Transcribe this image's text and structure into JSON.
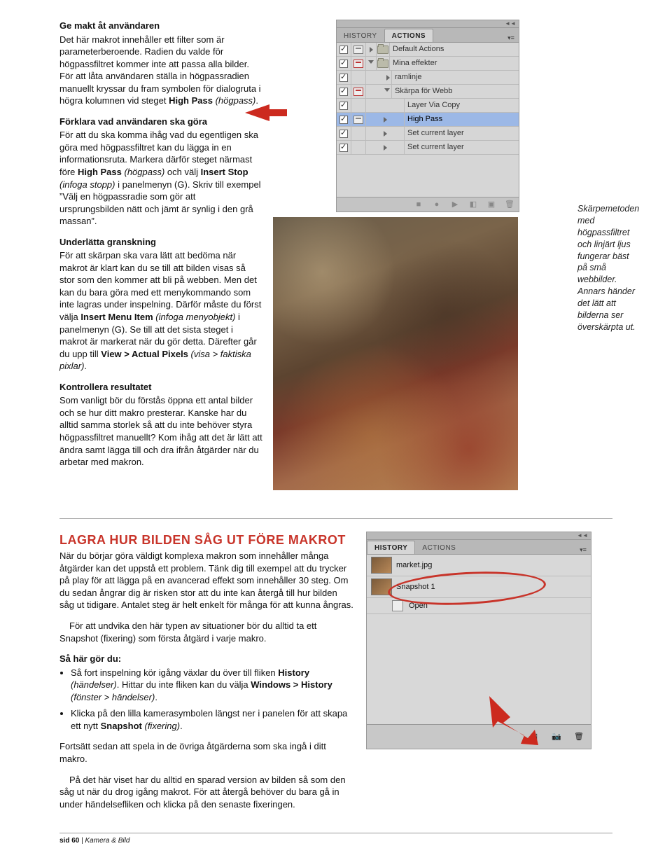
{
  "article": {
    "s1_title": "Ge makt åt användaren",
    "s1_p1a": "Det här makrot innehåller ett filter som är parameterberoende. Radien du valde för högpassfiltret kommer inte att passa alla bilder. För att låta användaren ställa in högpassradien manuellt kryssar du fram symbolen för dialogruta i högra kolumnen vid steget ",
    "s1_p1b": "High Pass",
    "s1_p1c": " (högpass)",
    "s2_title": "Förklara vad användaren ska göra",
    "s2_p1a": "För att du ska komma ihåg vad du egentligen ska göra med högpassfiltret kan du lägga in en informationsruta. Markera därför steget närmast före ",
    "s2_p1b": "High Pass",
    "s2_p1c": " (högpass)",
    "s2_p1d": " och välj ",
    "s2_p1e": "Insert Stop",
    "s2_p1f": " (infoga stopp)",
    "s2_p1g": " i panelmenyn (G). Skriv till exempel ”Välj en högpassradie som gör att ursprungsbilden nätt och jämt är synlig i den grå massan”.",
    "s3_title": "Underlätta granskning",
    "s3_p1a": "För att skärpan ska vara lätt att bedöma när makrot är klart kan du se till att bilden visas så stor som den kommer att bli på webben. Men det kan du bara göra med ett menykommando som inte lagras under inspelning. Därför måste du först välja ",
    "s3_p1b": "Insert Menu Item",
    "s3_p1c": " (infoga menyobjekt)",
    "s3_p1d": " i panelmenyn (G). Se till att det sista steget i makrot är markerat när du gör detta. Därefter går du upp till ",
    "s3_p1e": "View > Actual Pixels",
    "s3_p1f": " (visa > faktiska pixlar)",
    "s4_title": "Kontrollera resultatet",
    "s4_p1": "Som vanligt bör du förstås öppna ett antal bilder och se hur ditt makro presterar. Kanske har du alltid samma storlek så att du inte behöver styra högpassfiltret manuellt? Kom ihåg att det är lätt att ändra samt lägga till och dra ifrån åtgärder när du arbetar med makron."
  },
  "actions_panel": {
    "tab_history": "HISTORY",
    "tab_actions": "ACTIONS",
    "rows": {
      "default": "Default Actions",
      "mina": "Mina effekter",
      "ramlinje": "ramlinje",
      "skarpa": "Skärpa för Webb",
      "layer": "Layer Via Copy",
      "highpass": "High Pass",
      "setcur1": "Set current layer",
      "setcur2": "Set current layer"
    },
    "footer_icons": [
      "■",
      "●",
      "▶",
      "◧",
      "▣",
      "🗑"
    ]
  },
  "caption": "Skärpemetoden med högpassfiltret och linjärt ljus fungerar bäst på små webbilder. Annars händer det lätt att bilderna ser överskärpta ut.",
  "box": {
    "title": "Lagra hur bilden såg ut före makrot",
    "p1": "När du börjar göra väldigt komplexa makron som innehåller många åtgärder kan det uppstå ett problem. Tänk dig till exempel att du trycker på play för att lägga på en avancerad effekt som innehåller 30 steg. Om du sedan ångrar dig är risken stor att du inte kan återgå till hur bilden såg ut tidigare. Antalet steg är helt enkelt för många för att kunna ångras.",
    "p2": "För att undvika den här typen av situationer bör du alltid ta ett Snapshot (fixering) som första åtgärd i varje makro.",
    "howto": "Så här gör du:",
    "li1a": "Så fort inspelning kör igång växlar du över till fliken ",
    "li1b": "History",
    "li1c": " (händelser)",
    "li1d": ". Hittar du inte fliken kan du välja ",
    "li1e": "Windows > History",
    "li1f": " (fönster > händelser)",
    "li2a": "Klicka på den lilla kamerasymbolen längst ner i panelen för att skapa ett nytt ",
    "li2b": "Snapshot",
    "li2c": " (fixering)",
    "p3": "Fortsätt sedan att spela in de övriga åtgärderna som ska ingå i ditt makro.",
    "p4": "På det här viset har du alltid en sparad version av bilden så som den såg ut när du drog igång makrot. För att återgå behöver du bara gå in under händelsefliken och klicka på den senaste fixeringen."
  },
  "history_panel": {
    "tab_history": "HISTORY",
    "tab_actions": "ACTIONS",
    "file": "market.jpg",
    "snap": "Snapshot 1",
    "open": "Open"
  },
  "footer": {
    "page": "sid 60",
    "sep": " | ",
    "mag": "Kamera & Bild"
  }
}
